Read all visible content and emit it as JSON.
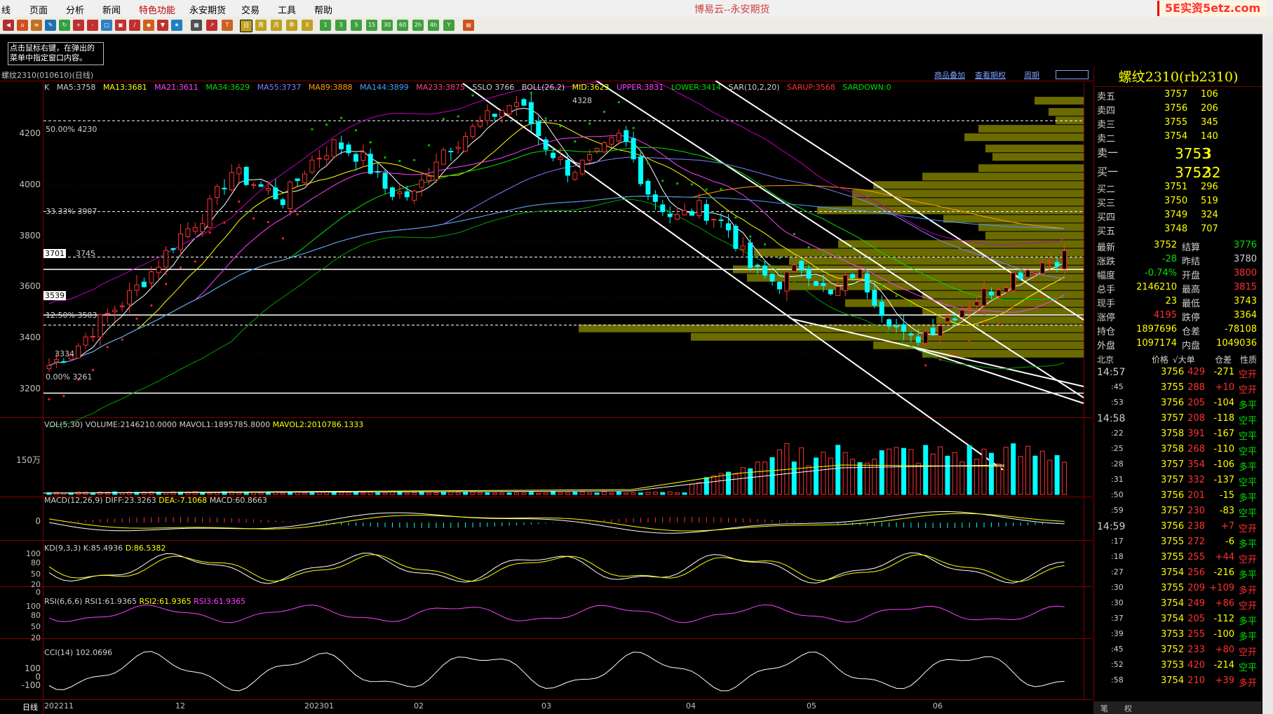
{
  "app": {
    "title": "博易云--永安期货",
    "logo": "5E实资5etz.com"
  },
  "menu": [
    {
      "label": "线"
    },
    {
      "label": "页面"
    },
    {
      "label": "分析"
    },
    {
      "label": "新闻"
    },
    {
      "label": "特色功能"
    },
    {
      "label": "永安期货"
    },
    {
      "label": "交易"
    },
    {
      "label": "工具"
    },
    {
      "label": "帮助"
    }
  ],
  "hint_text": "点击鼠标右键，在弹出的菜单中指定窗口内容。",
  "chart_header": {
    "symbol_label": "螺纹2310(010610)(日线)",
    "links": [
      "商品叠加",
      "查看期权",
      "周期"
    ]
  },
  "indicators": {
    "main": [
      "K",
      "MA5:3758",
      "MA13:3681",
      "MA21:3611",
      "MA34:3629",
      "MA55:3737",
      "MA89:3888",
      "MA144:3899",
      "MA233:3875",
      "SSLO 3766",
      "BOLL(26,2)",
      "MID:3623",
      "UPPER:3831",
      "LOWER:3414",
      "SAR(10,2,20)",
      "SARUP:3568",
      "SARDOWN:0"
    ],
    "vol": [
      "VOL(5,30)",
      "VOLUME:2146210.0000",
      "MAVOL1:1895785.8000",
      "MAVOL2:2010786.1333"
    ],
    "macd": [
      "MACD(12,26,9)",
      "DIFF:23.3263",
      "DEA:-7.1068",
      "MACD:60.8663"
    ],
    "kd": [
      "KD(9,3,3)",
      "K:85.4936",
      "D:86.5382"
    ],
    "rsi": [
      "RSI(6,6,6)",
      "RSI1:61.9365",
      "RSI2:61.9365",
      "RSI3:61.9365"
    ],
    "cci": [
      "CCI(14)",
      "102.0696"
    ]
  },
  "colors": {
    "up": "#ff3030",
    "down": "#00ffff",
    "fib": "#ffffff",
    "volume_profile": "#6b6b00"
  },
  "price_axis": [
    "4200",
    "4000",
    "3800",
    "3600",
    "3400",
    "3200"
  ],
  "fib_labels": [
    "50.00% 4230",
    "33.33% 3907",
    "3745",
    "12.50% 3503",
    "0.00% 3261"
  ],
  "price_tags": [
    "3701",
    "3539"
  ],
  "extreme_labels": {
    "high": "4328",
    "low": "3334"
  },
  "vol_axis": "150万",
  "macd_axis": "0",
  "kd_axis": [
    "100",
    "80",
    "50",
    "20",
    "0"
  ],
  "rsi_axis": [
    "100",
    "80",
    "50",
    "20"
  ],
  "cci_axis": [
    "100",
    "0",
    "-100"
  ],
  "x_axis": [
    "日线",
    "202211",
    "12",
    "202301",
    "02",
    "03",
    "04",
    "05",
    "06"
  ],
  "quote": {
    "title": "螺纹2310(rb2310)",
    "asks": [
      {
        "label": "卖五",
        "price": "3757",
        "vol": "106"
      },
      {
        "label": "卖四",
        "price": "3756",
        "vol": "206"
      },
      {
        "label": "卖三",
        "price": "3755",
        "vol": "345"
      },
      {
        "label": "卖二",
        "price": "3754",
        "vol": "140"
      },
      {
        "label": "卖一",
        "price": "3753",
        "vol": "3"
      }
    ],
    "bids": [
      {
        "label": "买一",
        "price": "3752",
        "vol": "32"
      },
      {
        "label": "买二",
        "price": "3751",
        "vol": "296"
      },
      {
        "label": "买三",
        "price": "3750",
        "vol": "519"
      },
      {
        "label": "买四",
        "price": "3749",
        "vol": "324"
      },
      {
        "label": "买五",
        "price": "3748",
        "vol": "707"
      }
    ],
    "stats": [
      [
        "最新",
        "3752",
        "结算",
        "3776"
      ],
      [
        "涨跌",
        "-28",
        "昨结",
        "3780"
      ],
      [
        "幅度",
        "-0.74%",
        "开盘",
        "3800"
      ],
      [
        "总手",
        "2146210",
        "最高",
        "3815"
      ],
      [
        "现手",
        "23",
        "最低",
        "3743"
      ],
      [
        "涨停",
        "4195",
        "跌停",
        "3364"
      ],
      [
        "持仓",
        "1897696",
        "仓差",
        "-78108"
      ],
      [
        "外盘",
        "1097174",
        "内盘",
        "1049036"
      ]
    ],
    "tick_header": [
      "北京",
      "价格",
      "√大单",
      "仓差",
      "性质"
    ],
    "ticks": [
      [
        "14:57",
        "3756",
        "429",
        "-271",
        "空开"
      ],
      [
        ":45",
        "3755",
        "288",
        "+10",
        "空开"
      ],
      [
        ":53",
        "3756",
        "205",
        "-104",
        "多平"
      ],
      [
        "14:58",
        "3757",
        "208",
        "-118",
        "空平"
      ],
      [
        ":22",
        "3758",
        "391",
        "-167",
        "空平"
      ],
      [
        ":25",
        "3758",
        "268",
        "-110",
        "空平"
      ],
      [
        ":28",
        "3757",
        "354",
        "-106",
        "多平"
      ],
      [
        ":31",
        "3757",
        "332",
        "-137",
        "空平"
      ],
      [
        ":50",
        "3756",
        "201",
        "-15",
        "多平"
      ],
      [
        ":59",
        "3757",
        "230",
        "-83",
        "空平"
      ],
      [
        "14:59",
        "3756",
        "238",
        "+7",
        "空开"
      ],
      [
        ":17",
        "3755",
        "272",
        "-6",
        "多平"
      ],
      [
        ":18",
        "3755",
        "255",
        "+44",
        "空开"
      ],
      [
        ":27",
        "3754",
        "256",
        "-216",
        "多平"
      ],
      [
        ":30",
        "3755",
        "209",
        "+109",
        "多开"
      ],
      [
        ":30",
        "3754",
        "249",
        "+86",
        "空开"
      ],
      [
        ":37",
        "3754",
        "205",
        "-112",
        "多平"
      ],
      [
        ":39",
        "3753",
        "255",
        "-100",
        "多平"
      ],
      [
        ":45",
        "3752",
        "233",
        "+80",
        "空开"
      ],
      [
        ":52",
        "3753",
        "420",
        "-214",
        "空平"
      ],
      [
        ":58",
        "3754",
        "210",
        "+39",
        "多开"
      ]
    ],
    "bottom_tabs": [
      "笔",
      "权"
    ]
  },
  "chart_data": {
    "type": "candlestick",
    "price_range": [
      3180,
      4360
    ],
    "channel_lines": "descending parallel channel",
    "approx_close_path": [
      3360,
      3420,
      3520,
      3600,
      3700,
      3820,
      3900,
      4050,
      4000,
      3950,
      4080,
      4150,
      4100,
      3980,
      3960,
      4120,
      4180,
      4250,
      4300,
      4150,
      4050,
      4100,
      4180,
      3980,
      3880,
      3920,
      3860,
      3700,
      3650,
      3720,
      3600,
      3700,
      3560,
      3440,
      3500,
      3560,
      3620,
      3680,
      3720,
      3752
    ]
  }
}
